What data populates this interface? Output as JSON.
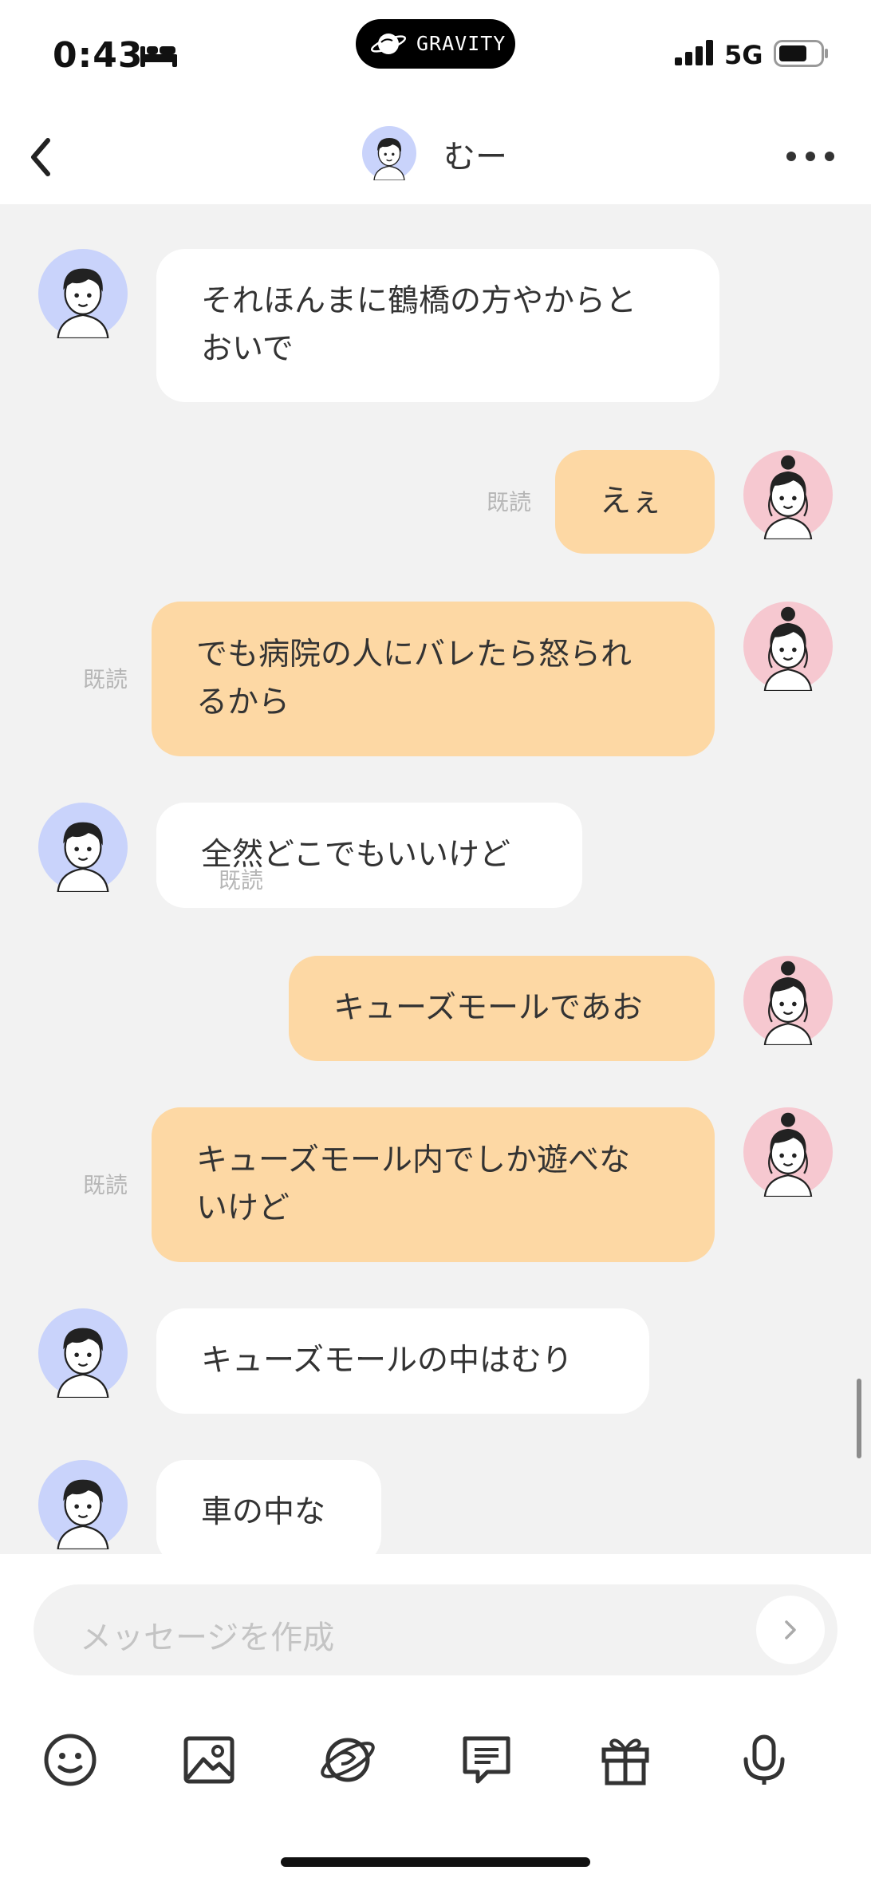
{
  "status_bar": {
    "time": "0:43",
    "island_label": "GRAVITY",
    "network": "5G"
  },
  "header": {
    "title": "むー"
  },
  "messages": [
    {
      "side": "in",
      "lines": [
        "それほんまに鶴橋の方やからと",
        "おいで"
      ]
    },
    {
      "side": "out",
      "read": "既読",
      "lines": [
        "えぇ"
      ]
    },
    {
      "side": "out",
      "read": "既読",
      "lines": [
        "でも病院の人にバレたら怒られ",
        "るから"
      ]
    },
    {
      "side": "in",
      "lines": [
        "全然どこでもいいけど"
      ]
    },
    {
      "side": "out",
      "read": "既読",
      "lines": [
        "キューズモールであお"
      ]
    },
    {
      "side": "out",
      "read": "既読",
      "lines": [
        "キューズモール内でしか遊べな",
        "いけど"
      ]
    },
    {
      "side": "in",
      "lines": [
        "キューズモールの中はむり"
      ]
    },
    {
      "side": "in",
      "lines": [
        "車の中な"
      ]
    }
  ],
  "composer": {
    "placeholder": "メッセージを作成"
  },
  "toolbar": [
    "emoji-icon",
    "image-icon",
    "planet-icon",
    "quick-reply-icon",
    "gift-icon",
    "microphone-icon"
  ],
  "colors": {
    "incoming_bubble": "#ffffff",
    "outgoing_bubble": "#fdd8a4",
    "background": "#f2f2f2",
    "self_avatar_bg": "#f6c8d0",
    "partner_avatar_bg": "#c9d3fb"
  }
}
